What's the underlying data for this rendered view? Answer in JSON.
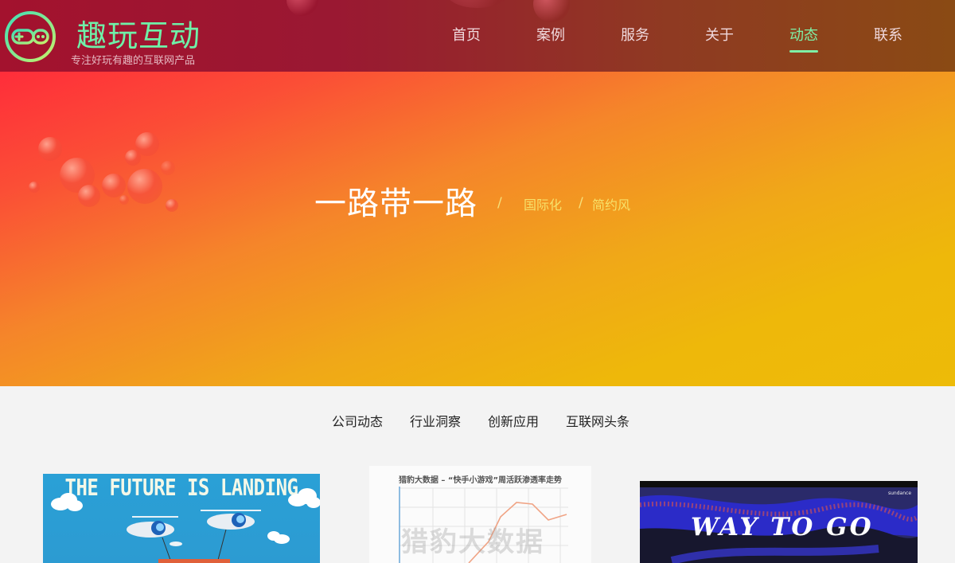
{
  "header": {
    "brand_name": "趣玩互动",
    "slogan": "专注好玩有趣的互联网产品",
    "logo_icon": "gamepad-icon",
    "nav": [
      {
        "label": "首页",
        "active": false
      },
      {
        "label": "案例",
        "active": false
      },
      {
        "label": "服务",
        "active": false
      },
      {
        "label": "关于",
        "active": false
      },
      {
        "label": "动态",
        "active": true
      },
      {
        "label": "联系",
        "active": false
      }
    ]
  },
  "hero": {
    "title": "一路带一路",
    "separator": "/",
    "tags": [
      "国际化",
      "简约风"
    ]
  },
  "tabs": [
    "公司动态",
    "行业洞察",
    "创新应用",
    "互联网头条"
  ],
  "cards": [
    {
      "caption": "THE FUTURE IS LANDING"
    },
    {
      "chart_title": "猎豹大数据 – “快手小游戏”周活跃渗透率走势",
      "watermark": "猎豹大数据"
    },
    {
      "film_title": "WAY TO GO",
      "badge": "sundance"
    }
  ],
  "colors": {
    "accent": "#7ef0a6",
    "header_bg": "#9a1832",
    "hero_start": "#ff2d3a",
    "hero_end": "#edbb08",
    "tag_color": "#f7e16a"
  }
}
